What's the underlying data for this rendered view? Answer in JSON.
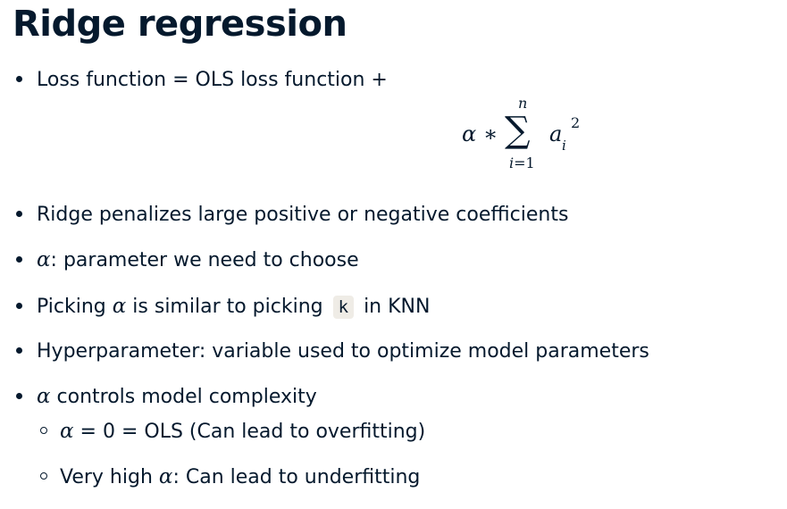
{
  "title": "Ridge regression",
  "bullets": {
    "loss": "Loss function = OLS loss function +",
    "penalizes": "Ridge penalizes large positive or negative coefficients",
    "alpha_param_symbol": "α",
    "alpha_param_text": ": parameter we need to choose",
    "picking_prefix": "Picking ",
    "picking_symbol": "α",
    "picking_middle": " is similar to picking ",
    "picking_code": "k",
    "picking_suffix": " in KNN",
    "hyper": "Hyperparameter: variable used to optimize model parameters",
    "controls_symbol": "α",
    "controls_text": " controls model complexity"
  },
  "sub_bullets": {
    "ols_symbol": "α",
    "ols_text": " = 0 = OLS (Can lead to overfitting)",
    "high_prefix": "Very high ",
    "high_symbol": "α",
    "high_suffix": ": Can lead to underfitting"
  },
  "formula": {
    "alpha": "α",
    "times": "∗",
    "sum": "∑",
    "upper": "n",
    "lower_var": "i",
    "lower_rest": "=1",
    "term": "a",
    "term_sub": "i",
    "term_sup": "2"
  }
}
